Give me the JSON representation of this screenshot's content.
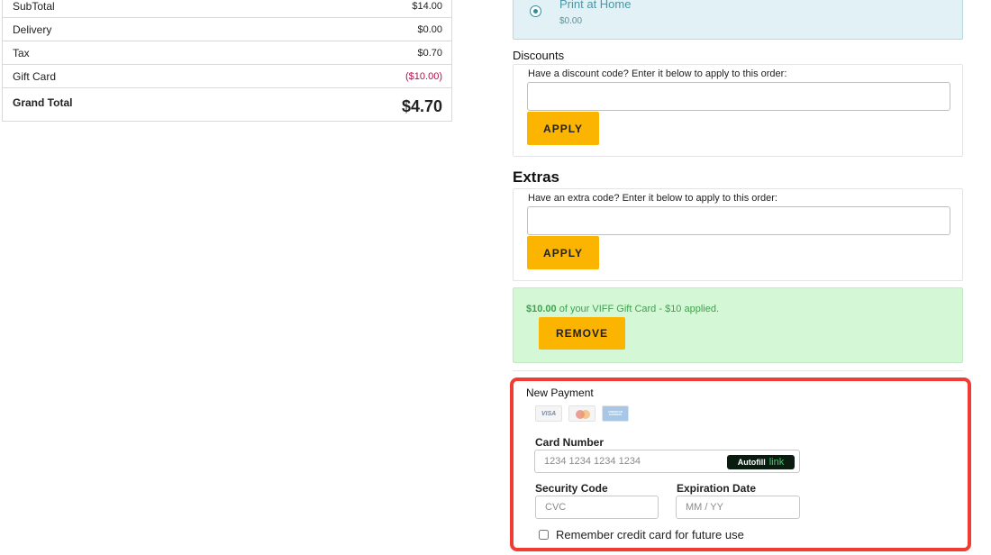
{
  "summary": {
    "rows": [
      {
        "label": "SubTotal",
        "value": "$14.00"
      },
      {
        "label": "Delivery",
        "value": "$0.00"
      },
      {
        "label": "Tax",
        "value": "$0.70"
      },
      {
        "label": "Gift Card",
        "value": "($10.00)"
      }
    ],
    "grand_total_label": "Grand Total",
    "grand_total_value": "$4.70"
  },
  "delivery": {
    "name": "Print at Home",
    "price": "$0.00"
  },
  "discounts": {
    "label": "Discounts",
    "hint": "Have a discount code? Enter it below to apply to this order:",
    "button": "APPLY"
  },
  "extras": {
    "heading": "Extras",
    "hint": "Have an extra code? Enter it below to apply to this order:",
    "button": "APPLY"
  },
  "gift_card": {
    "amount": "$10.00",
    "text": " of your VIFF Gift Card - $10 applied.",
    "button": "REMOVE"
  },
  "payment": {
    "title": "New Payment",
    "cards": [
      "VISA",
      "AMERICAN EXPRESS"
    ],
    "card_number_label": "Card Number",
    "card_number_placeholder": "1234 1234 1234 1234",
    "autofill_label": "Autofill",
    "autofill_link": "link",
    "security_label": "Security Code",
    "security_placeholder": "CVC",
    "expiry_label": "Expiration Date",
    "expiry_placeholder": "MM / YY",
    "remember_label": "Remember credit card for future use"
  },
  "colors": {
    "accent": "#fbb400",
    "highlight": "#f03c32",
    "success_bg": "#d4f7d6"
  }
}
